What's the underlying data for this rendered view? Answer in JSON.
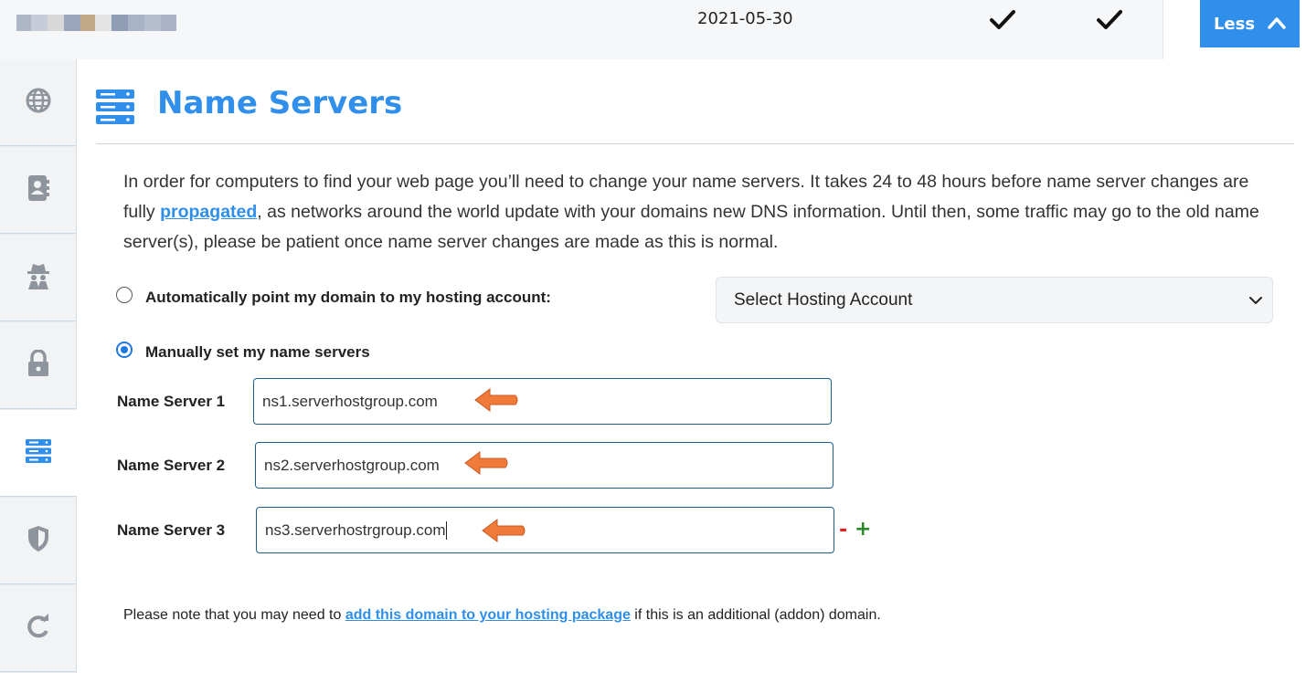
{
  "header": {
    "date": "2021-05-30",
    "less_button": "Less"
  },
  "sidebar": {
    "items": [
      {
        "icon": "globe-icon"
      },
      {
        "icon": "contact-book-icon"
      },
      {
        "icon": "privacy-spy-icon"
      },
      {
        "icon": "lock-icon"
      },
      {
        "icon": "server-icon",
        "active": true
      },
      {
        "icon": "shield-icon"
      },
      {
        "icon": "refresh-icon"
      }
    ]
  },
  "main": {
    "title": "Name Servers",
    "intro_before": "In order for computers to find your web page you’ll need to change your name servers. It takes 24 to 48 hours before name server changes are fully ",
    "intro_link": "propagated",
    "intro_after": ", as networks around the world update with your domains new DNS information. Until then, some traffic may go to the old name server(s), please be patient once name server changes are made as this is normal.",
    "option_auto": "Automatically point my domain to my hosting account:",
    "option_manual": "Manually set my name servers",
    "hosting_select": "Select Hosting Account",
    "name_servers": [
      {
        "label": "Name Server 1",
        "value": "ns1.serverhostgroup.com"
      },
      {
        "label": "Name Server 2",
        "value": "ns2.serverhostgroup.com"
      },
      {
        "label": "Name Server 3",
        "value": "ns3.serverhostrgroup.com"
      }
    ],
    "remove_symbol": "-",
    "add_symbol": "+",
    "note_before": "Please note that you may need to ",
    "note_link": "add this domain to your hosting package",
    "note_after": " if this is an additional (addon) domain."
  },
  "colors": {
    "accent": "#2f8fea",
    "arrow": "#f07a3a",
    "remove": "#e02020",
    "add": "#2a8a2a"
  }
}
